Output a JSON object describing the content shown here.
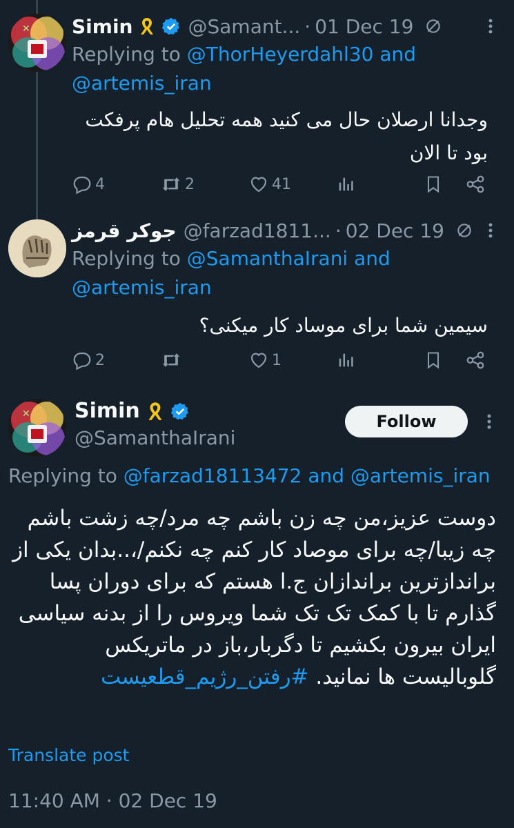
{
  "tweet1": {
    "name": "Simin",
    "handle": "@Samant...",
    "date": "01 Dec 19",
    "replying_prefix": "Replying to ",
    "mention1": "@ThorHeyerdahl30",
    "and": " and",
    "mention2": "@artemis_iran",
    "text_line1": "وجدانا ارصلان حال می کنید همه تحلیل هام پرفکت",
    "text_line2": "بود تا الان",
    "replies": "4",
    "reposts": "2",
    "likes": "41"
  },
  "tweet2": {
    "name": "جوکر قرمز",
    "handle": "@farzad1811...",
    "date": "02 Dec 19",
    "replying_prefix": "Replying to ",
    "mention1": "@SamanthaIrani",
    "and": " and",
    "mention2": "@artemis_iran",
    "text": "سیمین شما برای موساد کار میکنی؟",
    "replies": "2",
    "reposts": "",
    "likes": "1"
  },
  "main": {
    "name": "Simin",
    "handle": "@SamanthaIrani",
    "follow_label": "Follow",
    "replying_prefix": "Replying to ",
    "mention1": "@farzad18113472",
    "and": " and ",
    "mention2": "@artemis_iran",
    "text": "دوست عزیز،من چه زن باشم چه مرد/چه زشت باشم چه زیبا/چه برای موصاد کار کنم چه نکنم/،..بدان یکی از براندازترین براندازان ج.ا هستم که برای دوران پسا گذارم تا با کمک تک تک شما ویروس را از بدنه سیاسی ایران بیرون بکشیم تا دگربار،باز در ماتریکس گلوبالیست ها نمانید.",
    "hashtag": "#رفتن_رژیم_قطعیست",
    "translate": "Translate post",
    "timestamp": "11:40 AM · 02 Dec 19"
  },
  "colors": {
    "background": "#15202b",
    "text": "#f7f9f9",
    "secondary": "#8b98a5",
    "accent": "#1d9bf0",
    "ribbon": "#f5c518"
  }
}
